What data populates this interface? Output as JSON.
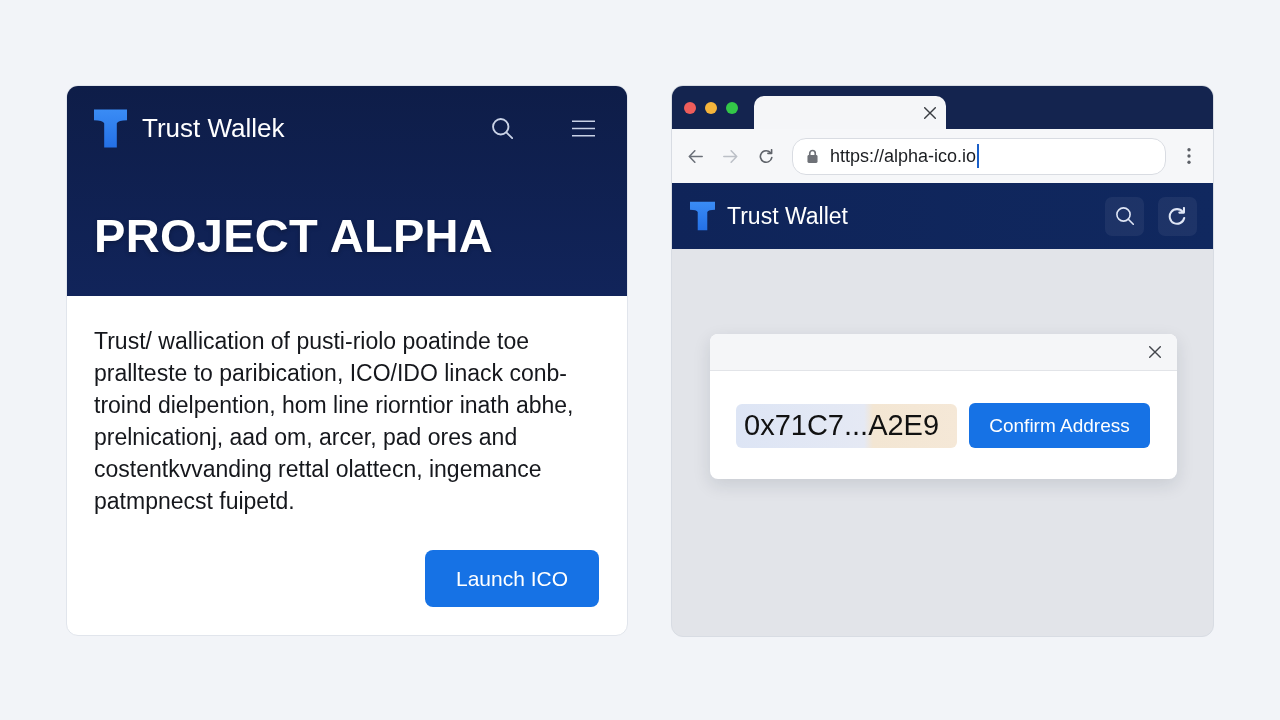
{
  "project_page": {
    "header": {
      "brand": "Trust Wallek"
    },
    "title": "PROJECT ALPHA",
    "description_lines": [
      "Trust/ wallication of pusti-riolo poatinde toe",
      "prallteste to paribication, ICO/IDO linack conb-",
      "troind dielpention, hom line riorntior inath abhe,",
      "prelnicationj, aad om, arcer, pad ores and",
      "costentkvvanding rettal olattecn, ingemance",
      "patmpnecst fuipetd."
    ],
    "launch_button": "Launch ICO"
  },
  "browser": {
    "forward_button": {
      "disabled": true
    },
    "url_field": {
      "value": "https://alpha-ico.io",
      "focused": true
    },
    "site_header": {
      "brand": "Trust Wallet"
    },
    "dialog": {
      "address": "0x71C7...A2E9",
      "confirm_button": "Confirm Address"
    }
  }
}
